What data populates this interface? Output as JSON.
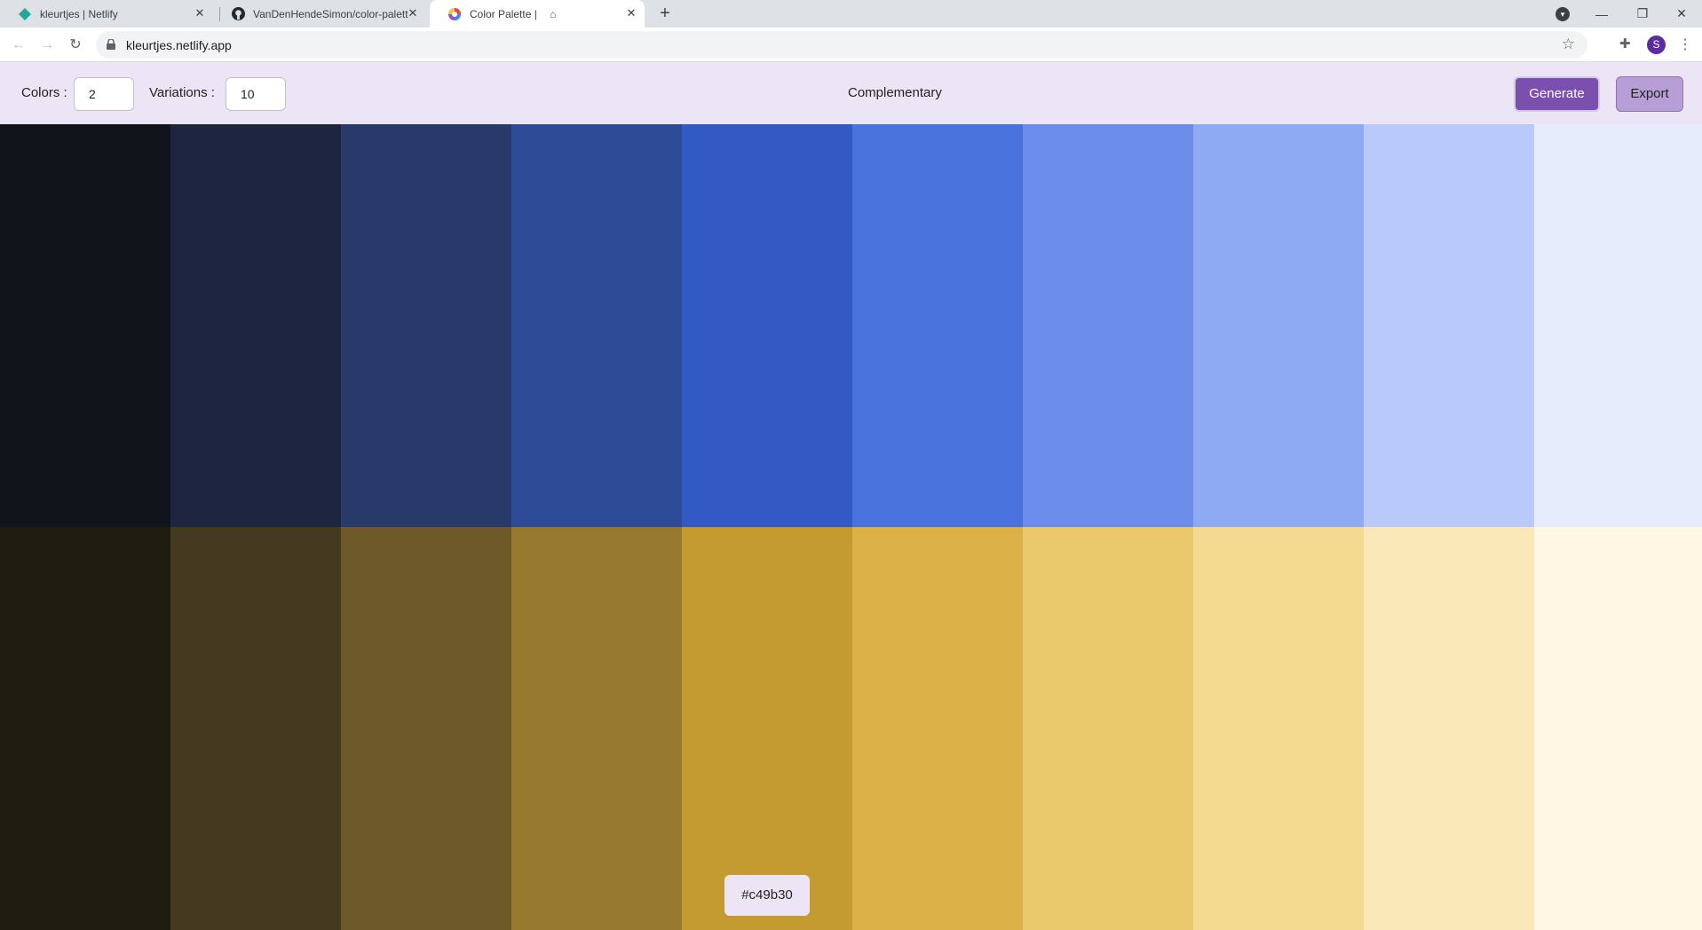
{
  "browser": {
    "tabs": [
      {
        "title": "kleurtjes | Netlify",
        "icon": "netlify-icon"
      },
      {
        "title": "VanDenHendeSimon/color-palette",
        "icon": "github-icon"
      },
      {
        "title": "Color Palette |",
        "icon": "color-wheel-icon"
      }
    ],
    "url": "kleurtjes.netlify.app",
    "profile_initial": "S"
  },
  "header": {
    "colors_label": "Colors :",
    "colors_value": "2",
    "variations_label": "Variations :",
    "variations_value": "10",
    "scheme": "Complementary",
    "generate_label": "Generate",
    "export_label": "Export"
  },
  "palette": {
    "rows": [
      [
        "#12141c",
        "#1d2540",
        "#273a6a",
        "#2e4b98",
        "#3259c4",
        "#4a72dc",
        "#6c8eea",
        "#8daaf2",
        "#b9cafa",
        "#e7ecfd"
      ],
      [
        "#1f1c12",
        "#433a20",
        "#6d5a28",
        "#97792f",
        "#c49b30",
        "#dbb148",
        "#eac86c",
        "#f4d991",
        "#fbe8b9",
        "#fff6e3"
      ]
    ],
    "hover_hex": "#c49b30"
  },
  "colors": {
    "accent": "#7b4fae",
    "header_bg": "#ece5f5"
  }
}
